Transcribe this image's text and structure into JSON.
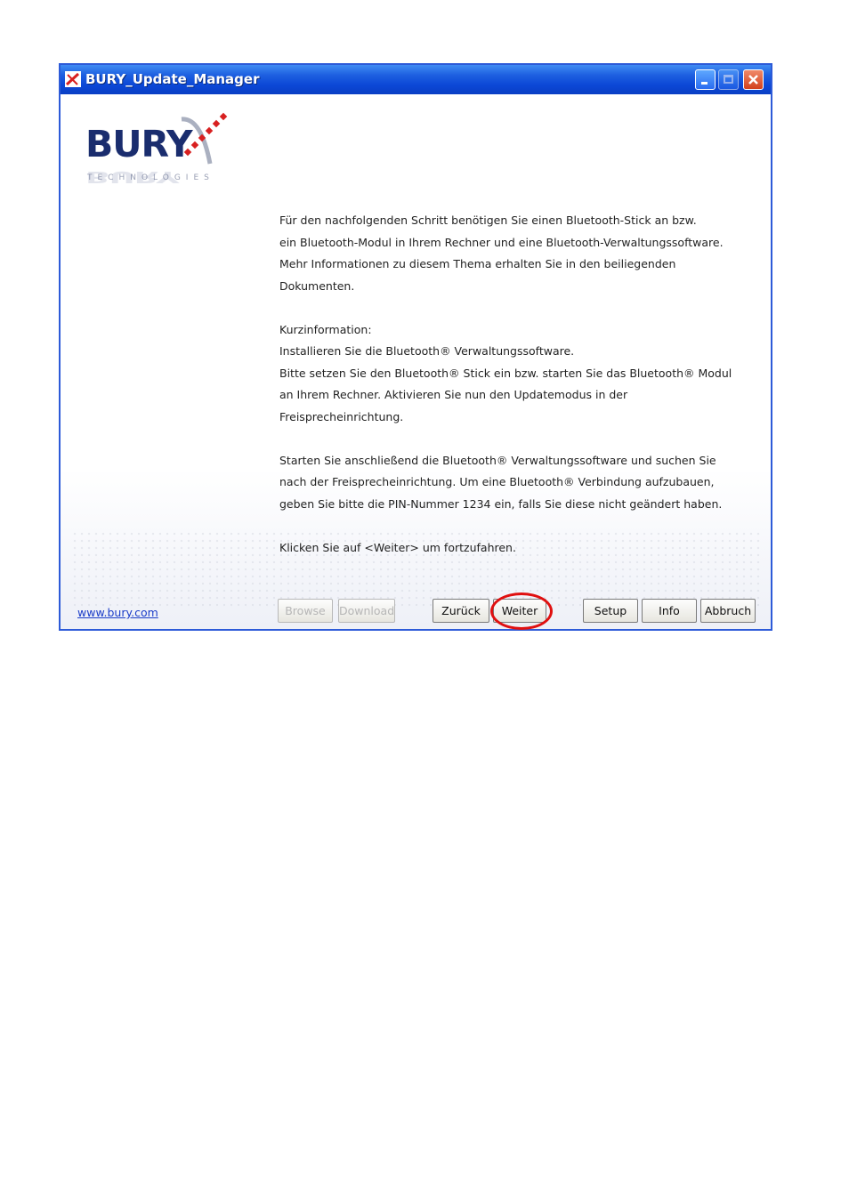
{
  "window": {
    "title": "BURY_Update_Manager",
    "accent": "#0b47d6"
  },
  "logo": {
    "name": "BURY",
    "subtitle": "TECHNOLOGIES"
  },
  "instructions": {
    "para1": [
      "Für den nachfolgenden Schritt benötigen Sie einen Bluetooth-Stick an bzw.",
      "ein Bluetooth-Modul in Ihrem Rechner und eine Bluetooth-Verwaltungssoftware.",
      "Mehr Informationen zu diesem Thema erhalten Sie in den beiliegenden Dokumenten."
    ],
    "para2": [
      "Kurzinformation:",
      "Installieren Sie die Bluetooth® Verwaltungssoftware.",
      "Bitte setzen Sie den Bluetooth® Stick ein bzw. starten Sie das Bluetooth® Modul",
      "an Ihrem Rechner. Aktivieren Sie nun den Updatemodus in der Freisprecheinrichtung."
    ],
    "para3": [
      "Starten Sie anschließend die Bluetooth® Verwaltungssoftware und suchen Sie",
      "nach der Freisprecheinrichtung. Um eine Bluetooth® Verbindung aufzubauen,",
      "geben Sie bitte die PIN-Nummer 1234 ein, falls Sie diese nicht geändert haben."
    ],
    "para4": "Klicken Sie auf <Weiter> um fortzufahren."
  },
  "footer": {
    "link": "www.bury.com",
    "buttons": {
      "browse": "Browse",
      "download": "Download",
      "back": "Zurück",
      "next": "Weiter",
      "setup": "Setup",
      "info": "Info",
      "cancel": "Abbruch"
    },
    "highlight_color": "#e01010"
  },
  "icons": [
    "app-icon",
    "minimize-icon",
    "maximize-icon",
    "close-icon"
  ]
}
